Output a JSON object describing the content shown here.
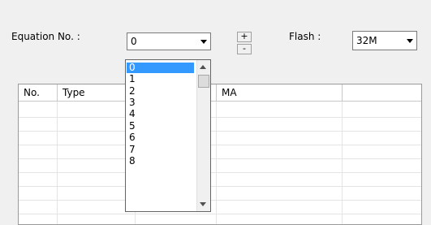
{
  "equation": {
    "label": "Equation No. :",
    "selected": "0",
    "options": [
      "0",
      "1",
      "2",
      "3",
      "4",
      "5",
      "6",
      "7",
      "8"
    ]
  },
  "stepper": {
    "plus": "+",
    "minus": "-"
  },
  "flash": {
    "label": "Flash :",
    "selected": "32M"
  },
  "table": {
    "columns": [
      "No.",
      "Type",
      "",
      "MA",
      ""
    ]
  },
  "colors": {
    "selection": "#3399ff"
  }
}
